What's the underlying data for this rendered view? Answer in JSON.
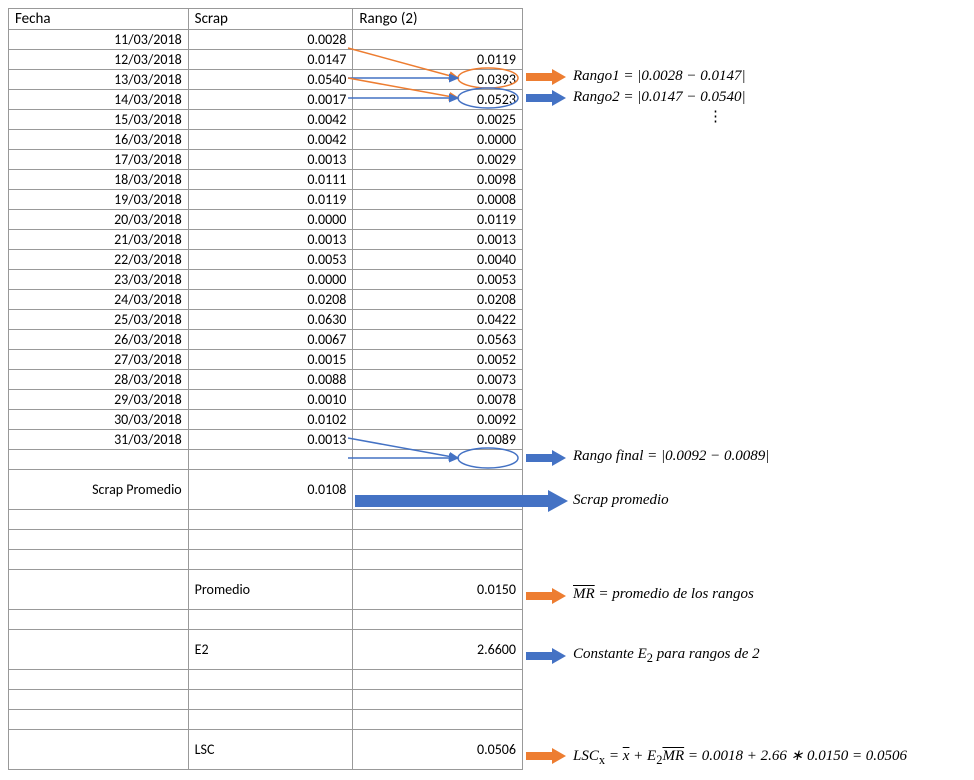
{
  "headers": {
    "fecha": "Fecha",
    "scrap": "Scrap",
    "rango": "Rango (2)"
  },
  "rows": [
    {
      "fecha": "11/03/2018",
      "scrap": "0.0028",
      "rango": ""
    },
    {
      "fecha": "12/03/2018",
      "scrap": "0.0147",
      "rango": "0.0119"
    },
    {
      "fecha": "13/03/2018",
      "scrap": "0.0540",
      "rango": "0.0393"
    },
    {
      "fecha": "14/03/2018",
      "scrap": "0.0017",
      "rango": "0.0523"
    },
    {
      "fecha": "15/03/2018",
      "scrap": "0.0042",
      "rango": "0.0025"
    },
    {
      "fecha": "16/03/2018",
      "scrap": "0.0042",
      "rango": "0.0000"
    },
    {
      "fecha": "17/03/2018",
      "scrap": "0.0013",
      "rango": "0.0029"
    },
    {
      "fecha": "18/03/2018",
      "scrap": "0.0111",
      "rango": "0.0098"
    },
    {
      "fecha": "19/03/2018",
      "scrap": "0.0119",
      "rango": "0.0008"
    },
    {
      "fecha": "20/03/2018",
      "scrap": "0.0000",
      "rango": "0.0119"
    },
    {
      "fecha": "21/03/2018",
      "scrap": "0.0013",
      "rango": "0.0013"
    },
    {
      "fecha": "22/03/2018",
      "scrap": "0.0053",
      "rango": "0.0040"
    },
    {
      "fecha": "23/03/2018",
      "scrap": "0.0000",
      "rango": "0.0053"
    },
    {
      "fecha": "24/03/2018",
      "scrap": "0.0208",
      "rango": "0.0208"
    },
    {
      "fecha": "25/03/2018",
      "scrap": "0.0630",
      "rango": "0.0422"
    },
    {
      "fecha": "26/03/2018",
      "scrap": "0.0067",
      "rango": "0.0563"
    },
    {
      "fecha": "27/03/2018",
      "scrap": "0.0015",
      "rango": "0.0052"
    },
    {
      "fecha": "28/03/2018",
      "scrap": "0.0088",
      "rango": "0.0073"
    },
    {
      "fecha": "29/03/2018",
      "scrap": "0.0010",
      "rango": "0.0078"
    },
    {
      "fecha": "30/03/2018",
      "scrap": "0.0102",
      "rango": "0.0092"
    },
    {
      "fecha": "31/03/2018",
      "scrap": "0.0013",
      "rango": "0.0089"
    }
  ],
  "scrap_promedio": {
    "label": "Scrap Promedio",
    "value": "0.0108"
  },
  "summary": {
    "promedio": {
      "label": "Promedio",
      "value": "0.0150"
    },
    "e2": {
      "label": "E2",
      "value": "2.6600"
    },
    "lsc": {
      "label": "LSC",
      "value": "0.0506"
    }
  },
  "annotations": {
    "rango1": "Rango1 =  |0.0028 − 0.0147|",
    "rango2": "Rango2 =  |0.0147 − 0.0540|",
    "rango_final": "Rango final =  |0.0092 − 0.0089|",
    "scrap_prom": "Scrap promedio",
    "mr": " = promedio de los rangos",
    "mr_var": "MR",
    "e2_note_a": "Constante E",
    "e2_note_b": " para rangos de 2",
    "e2_sub": "2",
    "lsc_var": "LSC",
    "lsc_sub": "x",
    "lsc_eq_a": " = ",
    "lsc_x": "x",
    "lsc_plus": " + E",
    "lsc_e2sub": "2",
    "lsc_mr": "MR",
    "lsc_rest": "  = 0.0018 + 2.66 ∗ 0.0150 = 0.0506"
  }
}
